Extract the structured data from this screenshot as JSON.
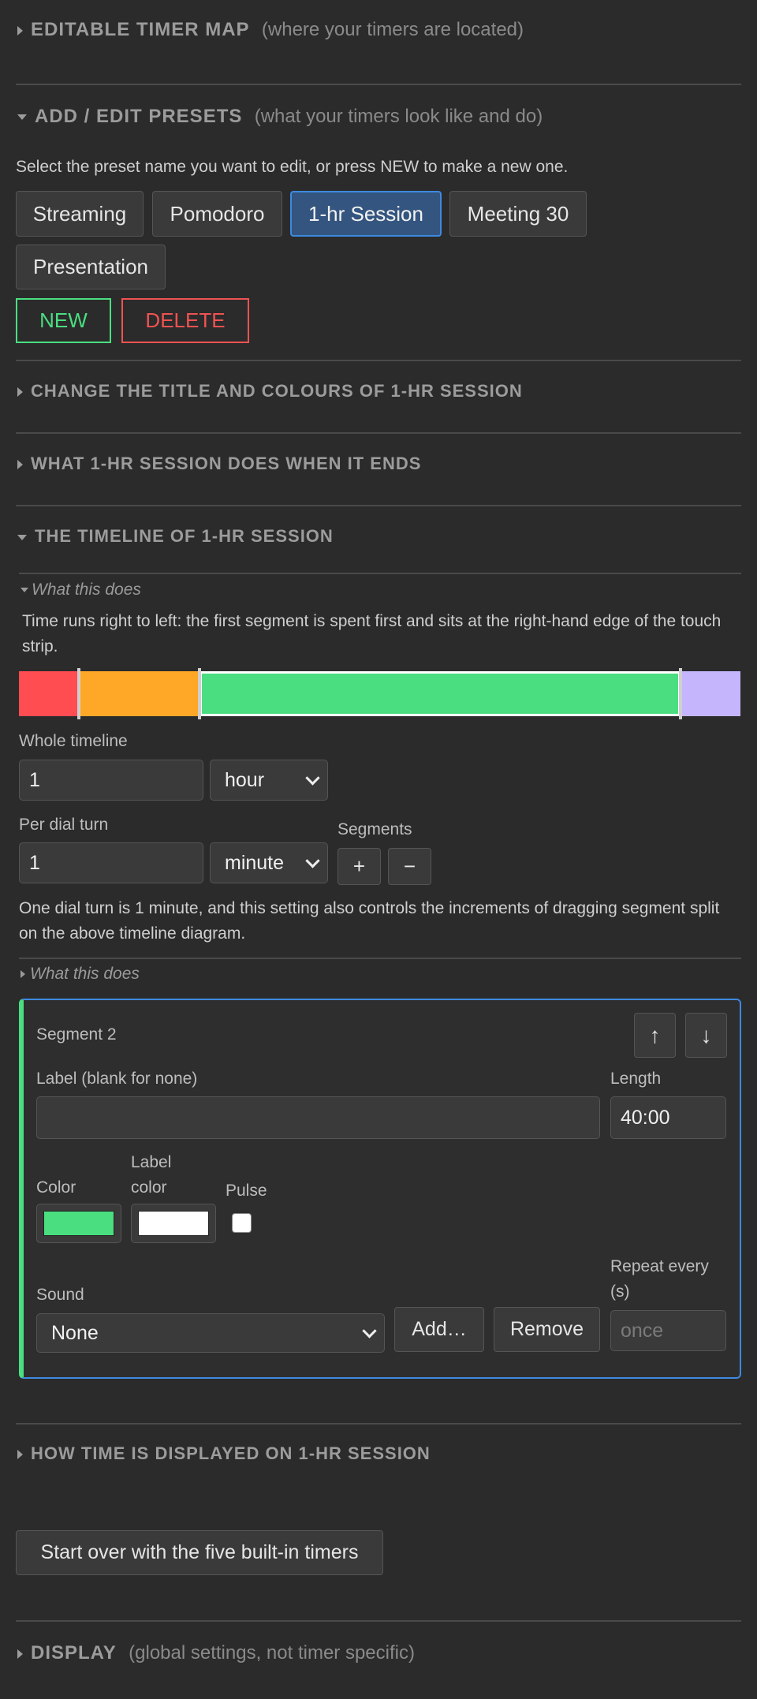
{
  "sections": {
    "timer_map": {
      "title": "EDITABLE TIMER MAP",
      "subtitle": "(where your timers are located)"
    },
    "presets": {
      "title": "ADD / EDIT PRESETS",
      "subtitle": "(what your timers look like and do)",
      "instructions": "Select the preset name you want to edit, or press NEW to make a new one.",
      "items": [
        "Streaming",
        "Pomodoro",
        "1-hr Session",
        "Meeting 30",
        "Presentation"
      ],
      "selected": "1-hr Session",
      "new_label": "NEW",
      "delete_label": "DELETE"
    },
    "title_colours": {
      "title": "CHANGE THE TITLE AND COLOURS OF 1-HR SESSION"
    },
    "when_ends": {
      "title": "WHAT 1-HR SESSION DOES WHEN IT ENDS"
    },
    "timeline": {
      "title": "THE TIMELINE OF 1-HR SESSION",
      "what_this_does": "What this does",
      "description": "Time runs right to left: the first segment is spent first and sits at the right-hand edge of the touch strip.",
      "strip_segments": [
        {
          "color": "#ff4d52",
          "fraction": 0.083
        },
        {
          "color": "#ffa726",
          "fraction": 0.167
        },
        {
          "color": "#4ade80",
          "fraction": 0.667,
          "selected": true
        },
        {
          "color": "#c4b5fd",
          "fraction": 0.083
        }
      ],
      "whole_label": "Whole timeline",
      "whole_value": "1",
      "whole_unit": "hour",
      "per_turn_label": "Per dial turn",
      "per_turn_value": "1",
      "per_turn_unit": "minute",
      "segments_label": "Segments",
      "plus": "+",
      "minus": "−",
      "dial_note": "One dial turn is 1 minute, and this setting also controls the increments of dragging segment split on the above timeline diagram.",
      "what_this_does_2": "What this does"
    },
    "segment": {
      "title": "Segment 2",
      "up": "↑",
      "down": "↓",
      "label_label": "Label (blank for none)",
      "label_value": "",
      "length_label": "Length",
      "length_value": "40:00",
      "color_label": "Color",
      "color_value": "#4ade80",
      "label_color_label_1": "Label",
      "label_color_label_2": "color",
      "label_color_value": "#ffffff",
      "pulse_label": "Pulse",
      "sound_label": "Sound",
      "sound_value": "None",
      "add_label": "Add…",
      "remove_label": "Remove",
      "repeat_label_1": "Repeat every",
      "repeat_label_2": "(s)",
      "repeat_placeholder": "once"
    },
    "time_display": {
      "title": "HOW TIME IS DISPLAYED ON 1-HR SESSION"
    },
    "start_over_label": "Start over with the five built-in timers",
    "display": {
      "title": "DISPLAY",
      "subtitle": "(global settings, not timer specific)"
    }
  },
  "colors": {
    "accent_blue": "#3d8ae0",
    "new_green": "#4ade80",
    "delete_red": "#f05252"
  }
}
